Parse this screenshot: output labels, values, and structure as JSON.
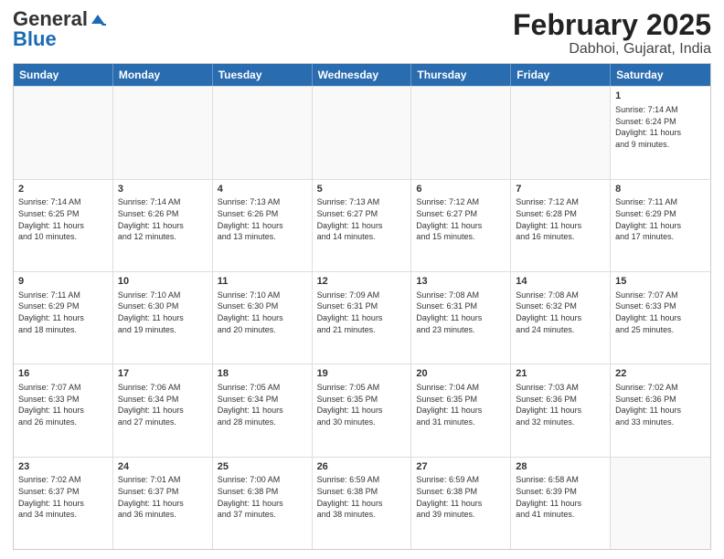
{
  "header": {
    "logo_general": "General",
    "logo_blue": "Blue",
    "month_title": "February 2025",
    "location": "Dabhoi, Gujarat, India"
  },
  "weekdays": [
    "Sunday",
    "Monday",
    "Tuesday",
    "Wednesday",
    "Thursday",
    "Friday",
    "Saturday"
  ],
  "rows": [
    [
      {
        "day": "",
        "info": "",
        "empty": true
      },
      {
        "day": "",
        "info": "",
        "empty": true
      },
      {
        "day": "",
        "info": "",
        "empty": true
      },
      {
        "day": "",
        "info": "",
        "empty": true
      },
      {
        "day": "",
        "info": "",
        "empty": true
      },
      {
        "day": "",
        "info": "",
        "empty": true
      },
      {
        "day": "1",
        "info": "Sunrise: 7:14 AM\nSunset: 6:24 PM\nDaylight: 11 hours\nand 9 minutes.",
        "empty": false
      }
    ],
    [
      {
        "day": "2",
        "info": "Sunrise: 7:14 AM\nSunset: 6:25 PM\nDaylight: 11 hours\nand 10 minutes.",
        "empty": false
      },
      {
        "day": "3",
        "info": "Sunrise: 7:14 AM\nSunset: 6:26 PM\nDaylight: 11 hours\nand 12 minutes.",
        "empty": false
      },
      {
        "day": "4",
        "info": "Sunrise: 7:13 AM\nSunset: 6:26 PM\nDaylight: 11 hours\nand 13 minutes.",
        "empty": false
      },
      {
        "day": "5",
        "info": "Sunrise: 7:13 AM\nSunset: 6:27 PM\nDaylight: 11 hours\nand 14 minutes.",
        "empty": false
      },
      {
        "day": "6",
        "info": "Sunrise: 7:12 AM\nSunset: 6:27 PM\nDaylight: 11 hours\nand 15 minutes.",
        "empty": false
      },
      {
        "day": "7",
        "info": "Sunrise: 7:12 AM\nSunset: 6:28 PM\nDaylight: 11 hours\nand 16 minutes.",
        "empty": false
      },
      {
        "day": "8",
        "info": "Sunrise: 7:11 AM\nSunset: 6:29 PM\nDaylight: 11 hours\nand 17 minutes.",
        "empty": false
      }
    ],
    [
      {
        "day": "9",
        "info": "Sunrise: 7:11 AM\nSunset: 6:29 PM\nDaylight: 11 hours\nand 18 minutes.",
        "empty": false
      },
      {
        "day": "10",
        "info": "Sunrise: 7:10 AM\nSunset: 6:30 PM\nDaylight: 11 hours\nand 19 minutes.",
        "empty": false
      },
      {
        "day": "11",
        "info": "Sunrise: 7:10 AM\nSunset: 6:30 PM\nDaylight: 11 hours\nand 20 minutes.",
        "empty": false
      },
      {
        "day": "12",
        "info": "Sunrise: 7:09 AM\nSunset: 6:31 PM\nDaylight: 11 hours\nand 21 minutes.",
        "empty": false
      },
      {
        "day": "13",
        "info": "Sunrise: 7:08 AM\nSunset: 6:31 PM\nDaylight: 11 hours\nand 23 minutes.",
        "empty": false
      },
      {
        "day": "14",
        "info": "Sunrise: 7:08 AM\nSunset: 6:32 PM\nDaylight: 11 hours\nand 24 minutes.",
        "empty": false
      },
      {
        "day": "15",
        "info": "Sunrise: 7:07 AM\nSunset: 6:33 PM\nDaylight: 11 hours\nand 25 minutes.",
        "empty": false
      }
    ],
    [
      {
        "day": "16",
        "info": "Sunrise: 7:07 AM\nSunset: 6:33 PM\nDaylight: 11 hours\nand 26 minutes.",
        "empty": false
      },
      {
        "day": "17",
        "info": "Sunrise: 7:06 AM\nSunset: 6:34 PM\nDaylight: 11 hours\nand 27 minutes.",
        "empty": false
      },
      {
        "day": "18",
        "info": "Sunrise: 7:05 AM\nSunset: 6:34 PM\nDaylight: 11 hours\nand 28 minutes.",
        "empty": false
      },
      {
        "day": "19",
        "info": "Sunrise: 7:05 AM\nSunset: 6:35 PM\nDaylight: 11 hours\nand 30 minutes.",
        "empty": false
      },
      {
        "day": "20",
        "info": "Sunrise: 7:04 AM\nSunset: 6:35 PM\nDaylight: 11 hours\nand 31 minutes.",
        "empty": false
      },
      {
        "day": "21",
        "info": "Sunrise: 7:03 AM\nSunset: 6:36 PM\nDaylight: 11 hours\nand 32 minutes.",
        "empty": false
      },
      {
        "day": "22",
        "info": "Sunrise: 7:02 AM\nSunset: 6:36 PM\nDaylight: 11 hours\nand 33 minutes.",
        "empty": false
      }
    ],
    [
      {
        "day": "23",
        "info": "Sunrise: 7:02 AM\nSunset: 6:37 PM\nDaylight: 11 hours\nand 34 minutes.",
        "empty": false
      },
      {
        "day": "24",
        "info": "Sunrise: 7:01 AM\nSunset: 6:37 PM\nDaylight: 11 hours\nand 36 minutes.",
        "empty": false
      },
      {
        "day": "25",
        "info": "Sunrise: 7:00 AM\nSunset: 6:38 PM\nDaylight: 11 hours\nand 37 minutes.",
        "empty": false
      },
      {
        "day": "26",
        "info": "Sunrise: 6:59 AM\nSunset: 6:38 PM\nDaylight: 11 hours\nand 38 minutes.",
        "empty": false
      },
      {
        "day": "27",
        "info": "Sunrise: 6:59 AM\nSunset: 6:38 PM\nDaylight: 11 hours\nand 39 minutes.",
        "empty": false
      },
      {
        "day": "28",
        "info": "Sunrise: 6:58 AM\nSunset: 6:39 PM\nDaylight: 11 hours\nand 41 minutes.",
        "empty": false
      },
      {
        "day": "",
        "info": "",
        "empty": true
      }
    ]
  ]
}
